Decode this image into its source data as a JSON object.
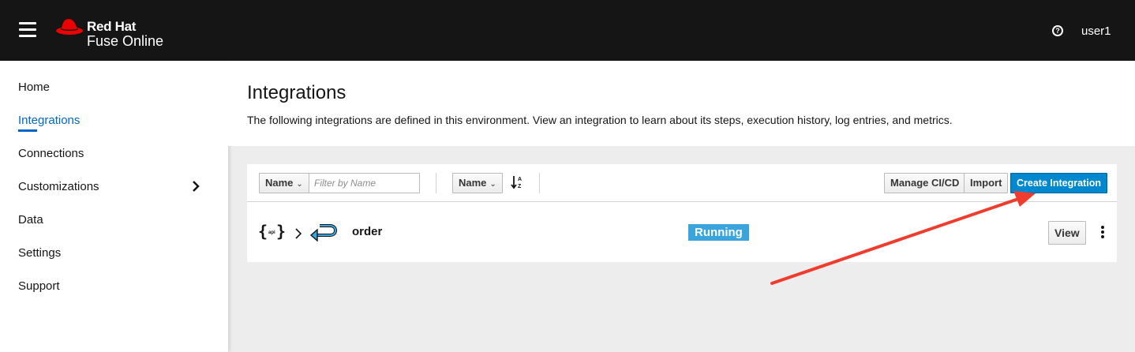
{
  "header": {
    "brand_line1": "Red Hat",
    "brand_line2": "Fuse Online",
    "help_glyph": "?",
    "username": "user1",
    "brand_color": "#ee0000"
  },
  "sidebar": {
    "items": [
      {
        "label": "Home"
      },
      {
        "label": "Integrations",
        "active": true
      },
      {
        "label": "Connections"
      },
      {
        "label": "Customizations",
        "expandable": true
      },
      {
        "label": "Data"
      },
      {
        "label": "Settings"
      },
      {
        "label": "Support"
      }
    ]
  },
  "page": {
    "title": "Integrations",
    "description": "The following integrations are defined in this environment. View an integration to learn about its steps, execution history, log entries, and metrics."
  },
  "toolbar": {
    "filter_field": "Name",
    "filter_placeholder": "Filter by Name",
    "sort_field": "Name",
    "sort_icon_text": "A Z",
    "manage_cicd_label": "Manage CI/CD",
    "import_label": "Import",
    "create_label": "Create Integration"
  },
  "integrations": [
    {
      "api_icon_text": "api",
      "name": "order",
      "status": "Running",
      "view_label": "View"
    }
  ],
  "annotation": {
    "arrow_color": "#f03c2c"
  }
}
